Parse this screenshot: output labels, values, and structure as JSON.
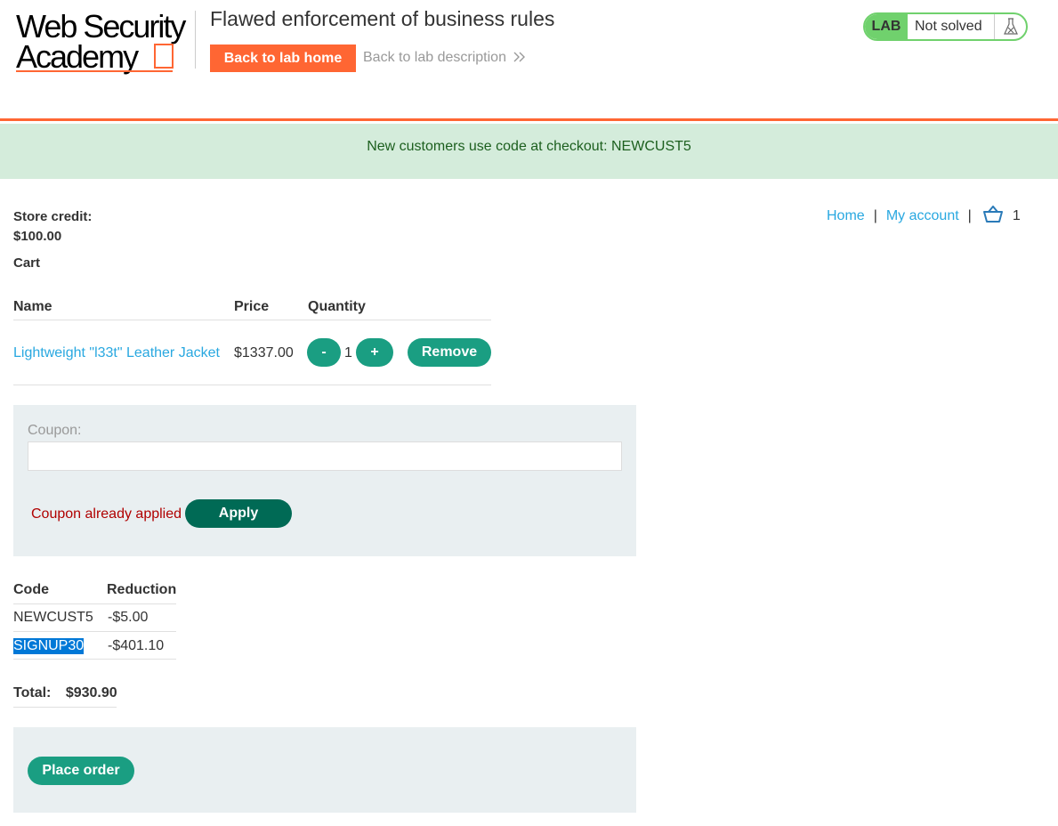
{
  "header": {
    "logo_line1": "Web Security",
    "logo_line2": "Academy",
    "lab_title": "Flawed enforcement of business rules",
    "back_home_label": "Back to lab home",
    "back_desc_label": "Back to lab description",
    "badge": {
      "label": "LAB",
      "status": "Not solved"
    }
  },
  "notice": "New customers use code at checkout: NEWCUST5",
  "nav": {
    "home": "Home",
    "account": "My account",
    "separator": "|",
    "cart_count": "1"
  },
  "account": {
    "credit_label": "Store credit:",
    "credit_value": "$100.00"
  },
  "cart": {
    "heading": "Cart",
    "columns": [
      "Name",
      "Price",
      "Quantity"
    ],
    "items": [
      {
        "name": "Lightweight \"l33t\" Leather Jacket",
        "price": "$1337.00",
        "quantity": "1",
        "decrement_label": "-",
        "increment_label": "+",
        "remove_label": "Remove"
      }
    ]
  },
  "coupon": {
    "label": "Coupon:",
    "value": "",
    "error": "Coupon already applied",
    "apply_label": "Apply"
  },
  "codes": {
    "columns": [
      "Code",
      "Reduction"
    ],
    "rows": [
      {
        "code": "NEWCUST5",
        "reduction": "-$5.00"
      },
      {
        "code": "SIGNUP30",
        "reduction": "-$401.10"
      }
    ]
  },
  "total": {
    "label": "Total:",
    "value": "$930.90"
  },
  "order": {
    "label": "Place order"
  },
  "colors": {
    "accent": "#ff6633",
    "link": "#29a8e0",
    "button": "#1a9e82",
    "apply_button": "#006a55",
    "badge": "#70d16d",
    "notice_bg": "#d4ecdb",
    "error": "#b00000"
  }
}
